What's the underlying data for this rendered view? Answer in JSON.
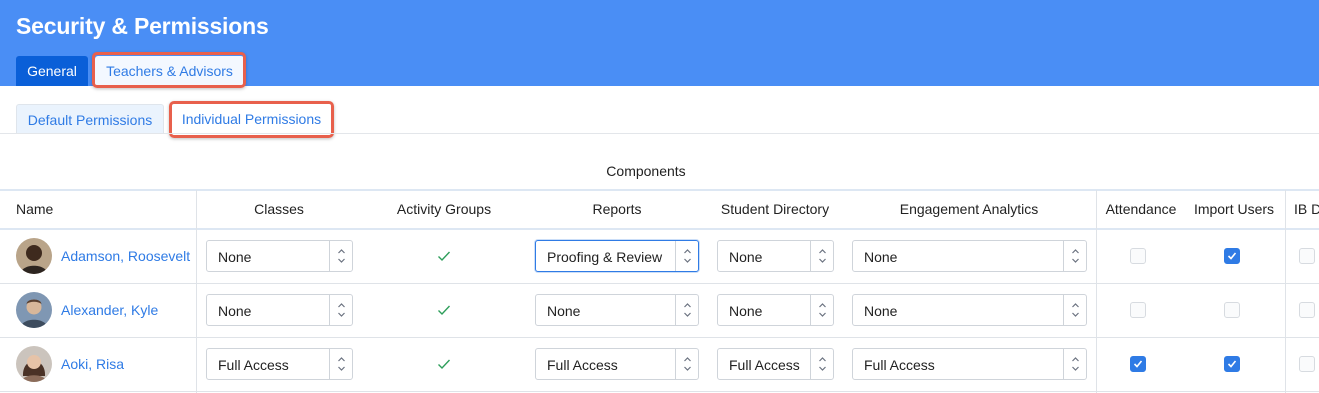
{
  "app": {
    "title": "Security & Permissions"
  },
  "tabs": [
    {
      "label": "General",
      "active": true
    },
    {
      "label": "Teachers & Advisors",
      "active": false
    }
  ],
  "subtabs": [
    {
      "label": "Default Permissions",
      "active": true
    },
    {
      "label": "Individual Permissions",
      "active": false
    }
  ],
  "table": {
    "group_header": "Components",
    "columns": [
      "Name",
      "Classes",
      "Activity Groups",
      "Reports",
      "Student Directory",
      "Engagement Analytics",
      "Attendance",
      "Import Users",
      "IB D"
    ],
    "rows": [
      {
        "name": "Adamson, Roosevelt",
        "avatar_icon": "person-avatar-icon",
        "classes": "None",
        "activity_groups": true,
        "reports": "Proofing & Review",
        "student_directory": "None",
        "engagement_analytics": "None",
        "attendance": false,
        "import_users": true,
        "ib": false
      },
      {
        "name": "Alexander, Kyle",
        "avatar_icon": "person-avatar-icon",
        "classes": "None",
        "activity_groups": true,
        "reports": "None",
        "student_directory": "None",
        "engagement_analytics": "None",
        "attendance": false,
        "import_users": false,
        "ib": false
      },
      {
        "name": "Aoki, Risa",
        "avatar_icon": "person-avatar-icon",
        "classes": "Full Access",
        "activity_groups": true,
        "reports": "Full Access",
        "student_directory": "Full Access",
        "engagement_analytics": "Full Access",
        "attendance": true,
        "import_users": true,
        "ib": false
      }
    ]
  },
  "colors": {
    "header_bg": "#4a8ef5",
    "active_tab": "#0a5fd8",
    "link": "#2f7be5",
    "highlight": "#e8604c"
  }
}
